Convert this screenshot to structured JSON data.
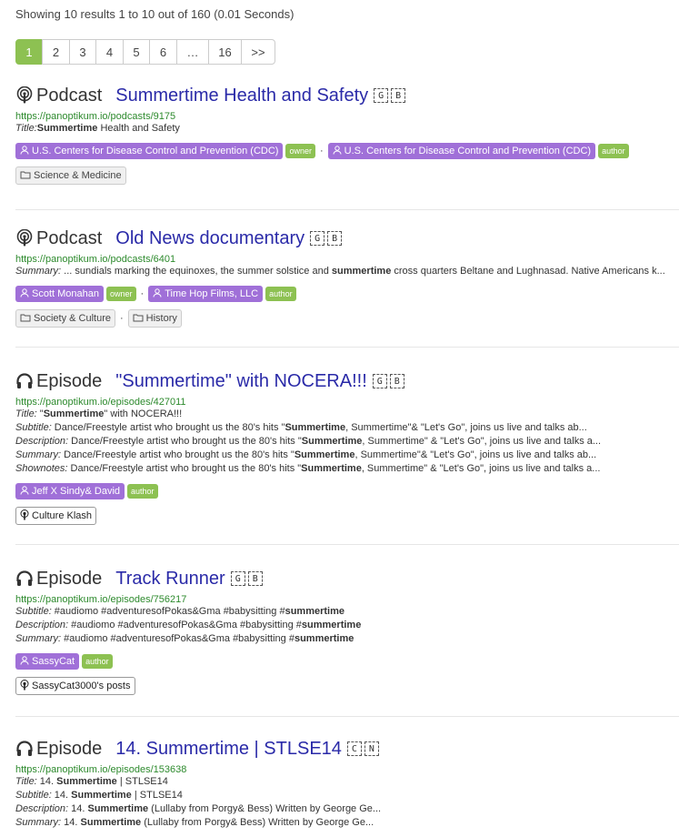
{
  "results_info": "Showing 10 results 1 to 10 out of 160 (0.01 Seconds)",
  "pagination": [
    {
      "label": "1",
      "active": true
    },
    {
      "label": "2"
    },
    {
      "label": "3"
    },
    {
      "label": "4"
    },
    {
      "label": "5"
    },
    {
      "label": "6"
    },
    {
      "label": "…"
    },
    {
      "label": "16"
    },
    {
      "label": ">>"
    }
  ],
  "results": [
    {
      "type": "Podcast",
      "title": "Summertime Health and Safety",
      "flags": [
        "G",
        "B"
      ],
      "url": "https://panoptikum.io/podcasts/9175",
      "fields": [
        {
          "label": "Title:",
          "parts": [
            {
              "b": "Summertime"
            },
            {
              "t": " Health and Safety"
            }
          ]
        }
      ],
      "people": [
        {
          "name": "U.S. Centers for Disease Control and Prevention (CDC)",
          "role": "owner"
        },
        {
          "name": "U.S. Centers for Disease Control and Prevention (CDC)",
          "role": "author"
        }
      ],
      "categories": [
        "Science & Medicine"
      ]
    },
    {
      "type": "Podcast",
      "title": "Old News documentary",
      "flags": [
        "G",
        "B"
      ],
      "url": "https://panoptikum.io/podcasts/6401",
      "fields": [
        {
          "label": "Summary:",
          "parts": [
            {
              "t": " ... sundials marking the equinoxes, the summer solstice and "
            },
            {
              "b": "summertime"
            },
            {
              "t": " cross quarters Beltane and Lughnasad. Native Americans k..."
            }
          ]
        }
      ],
      "people": [
        {
          "name": "Scott Monahan",
          "role": "owner"
        },
        {
          "name": "Time Hop Films, LLC",
          "role": "author"
        }
      ],
      "categories": [
        "Society & Culture",
        "History"
      ]
    },
    {
      "type": "Episode",
      "title": "\"Summertime\" with NOCERA!!!",
      "flags": [
        "G",
        "B"
      ],
      "url": "https://panoptikum.io/episodes/427011",
      "fields": [
        {
          "label": "Title:",
          "parts": [
            {
              "t": " \""
            },
            {
              "b": "Summertime"
            },
            {
              "t": "\" with NOCERA!!!"
            }
          ]
        },
        {
          "label": "Subtitle:",
          "parts": [
            {
              "t": " Dance/Freestyle artist who brought us the 80's hits \""
            },
            {
              "b": "Summertime"
            },
            {
              "t": ", Summertime\"& \"Let's Go\", joins us live and talks ab..."
            }
          ]
        },
        {
          "label": "Description:",
          "parts": [
            {
              "t": " Dance/Freestyle artist who brought us the 80's hits \""
            },
            {
              "b": "Summertime"
            },
            {
              "t": ", Summertime\" & \"Let's Go\", joins us live and talks a..."
            }
          ]
        },
        {
          "label": "Summary:",
          "parts": [
            {
              "t": " Dance/Freestyle artist who brought us the 80's hits \""
            },
            {
              "b": "Summertime"
            },
            {
              "t": ", Summertime\"& \"Let's Go\", joins us live and talks ab..."
            }
          ]
        },
        {
          "label": "Shownotes:",
          "parts": [
            {
              "t": " Dance/Freestyle artist who brought us the 80's hits \""
            },
            {
              "b": "Summertime"
            },
            {
              "t": ", Summertime\" & \"Let's Go\", joins us live and talks a..."
            }
          ]
        }
      ],
      "people": [
        {
          "name": "Jeff X Sindy& David",
          "role": "author"
        }
      ],
      "podcast": "Culture Klash"
    },
    {
      "type": "Episode",
      "title": "Track Runner",
      "flags": [
        "G",
        "B"
      ],
      "url": "https://panoptikum.io/episodes/756217",
      "fields": [
        {
          "label": "Subtitle:",
          "parts": [
            {
              "t": " #audiomo #adventuresofPokas&Gma #babysitting #"
            },
            {
              "b": "summertime"
            }
          ]
        },
        {
          "label": "Description:",
          "parts": [
            {
              "t": " #audiomo #adventuresofPokas&Gma #babysitting #"
            },
            {
              "b": "summertime"
            }
          ]
        },
        {
          "label": "Summary:",
          "parts": [
            {
              "t": " #audiomo #adventuresofPokas&Gma #babysitting #"
            },
            {
              "b": "summertime"
            }
          ]
        }
      ],
      "people": [
        {
          "name": "SassyCat",
          "role": "author"
        }
      ],
      "podcast": "SassyCat3000's posts"
    },
    {
      "type": "Episode",
      "title": "14. Summertime | STLSE14",
      "flags": [
        "C",
        "N"
      ],
      "url": "https://panoptikum.io/episodes/153638",
      "fields": [
        {
          "label": "Title:",
          "parts": [
            {
              "t": " 14. "
            },
            {
              "b": "Summertime"
            },
            {
              "t": " | STLSE14"
            }
          ]
        },
        {
          "label": "Subtitle:",
          "parts": [
            {
              "t": " 14. "
            },
            {
              "b": "Summertime"
            },
            {
              "t": " | STLSE14"
            }
          ]
        },
        {
          "label": "Description:",
          "parts": [
            {
              "t": " 14. "
            },
            {
              "b": "Summertime"
            },
            {
              "t": " (Lullaby from Porgy& Bess) Written by George Ge..."
            }
          ]
        },
        {
          "label": "Summary:",
          "parts": [
            {
              "t": " 14. "
            },
            {
              "b": "Summertime"
            },
            {
              "t": " (Lullaby from Porgy& Bess) Written by George Ge..."
            }
          ]
        }
      ]
    }
  ]
}
